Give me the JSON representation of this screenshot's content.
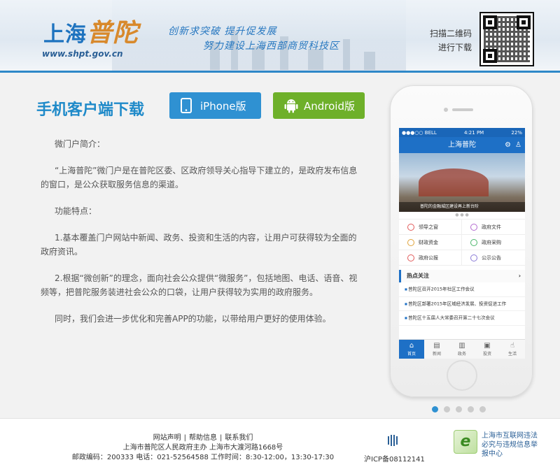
{
  "header": {
    "logo_main": "上海",
    "logo_accent": "普陀",
    "logo_url": "www.shpt.gov.cn",
    "slogan_line1": "创新求突破 提升促发展",
    "slogan_line2": "努力建设上海西部商贸科技区",
    "qr_line1": "扫描二维码",
    "qr_line2": "进行下载"
  },
  "main": {
    "title": "手机客户端下载",
    "iphone_label": "iPhone版",
    "android_label": "Android版",
    "paragraphs": [
      "微门户简介：",
      "“上海普陀”微门户是在普陀区委、区政府领导关心指导下建立的，是政府发布信息的窗口，是公众获取服务信息的渠道。",
      "功能特点：",
      "1.基本覆盖门户网站中新闻、政务、投资和生活的内容，让用户可获得较为全面的政府资讯。",
      "2.根据“微创新”的理念，面向社会公众提供“微服务”，包括地图、电话、语音、视频等，把普陀服务装进社会公众的口袋，让用户获得较为实用的政府服务。",
      "同时，我们会进一步优化和完善APP的功能，以带给用户更好的使用体验。"
    ]
  },
  "phone": {
    "carrier": "●●●○○ BELL",
    "time": "4:21 PM",
    "battery": "22%",
    "app_title": "上海普陀",
    "banner_caption": "普陀的金融城区建设再上新台阶",
    "grid": [
      {
        "label": "领导之窗",
        "color": "#e25a5a"
      },
      {
        "label": "政府文件",
        "color": "#b46ad0"
      },
      {
        "label": "财政资金",
        "color": "#e0a33a"
      },
      {
        "label": "政府采购",
        "color": "#4bb66b"
      },
      {
        "label": "政府公报",
        "color": "#e25a5a"
      },
      {
        "label": "公示公告",
        "color": "#8a7ad6"
      }
    ],
    "hot_title": "热点关注",
    "hot_items": [
      "普陀区召开2015年社区工作会议",
      "普陀区部署2015年区域经济发展、投资促进工作",
      "普陀区十五届人大常委召开第二十七次会议"
    ],
    "tabs": [
      "首页",
      "新闻",
      "政务",
      "投资",
      "生活"
    ]
  },
  "footer": {
    "link1": "网站声明",
    "link2": "帮助信息",
    "link3": "联系我们",
    "sep": "|",
    "line2": "上海市普陀区人民政府主办 上海市大渡河路1668号",
    "line3": "邮政编码：200333 电话：021-52564588 工作时间：8:30-12:00，13:30-17:30",
    "icp": "沪ICP备08112141",
    "report": "上海市互联网违法必究与违规信息举报中心"
  }
}
